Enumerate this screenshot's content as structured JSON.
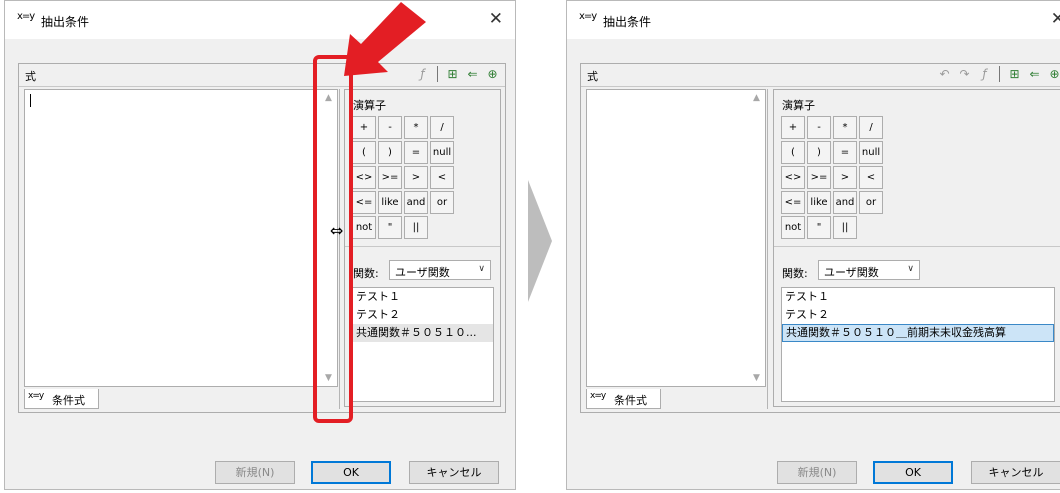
{
  "left": {
    "title": "抽出条件",
    "title_icon": "x=y",
    "formula_label": "式",
    "cond_tab_label": "条件式",
    "op_title": "演算子",
    "operators": [
      "+",
      "-",
      "*",
      "/",
      "(",
      ")",
      "=",
      "null",
      "<>",
      ">=",
      ">",
      "<",
      "<=",
      "like",
      "and",
      "or",
      "not",
      "\"",
      "||"
    ],
    "func_label": "関数:",
    "func_select": "ユーザ関数",
    "functions": [
      "テスト１",
      "テスト２",
      "共通関数＃５０５１０..."
    ],
    "btn_new": "新規(N)",
    "btn_ok": "OK",
    "btn_cancel": "キャンセル"
  },
  "right": {
    "title": "抽出条件",
    "title_icon": "x=y",
    "formula_label": "式",
    "cond_tab_label": "条件式",
    "op_title": "演算子",
    "operators": [
      "+",
      "-",
      "*",
      "/",
      "(",
      ")",
      "=",
      "null",
      "<>",
      ">=",
      ">",
      "<",
      "<=",
      "like",
      "and",
      "or",
      "not",
      "\"",
      "||"
    ],
    "func_label": "関数:",
    "func_select": "ユーザ関数",
    "functions": [
      "テスト１",
      "テスト２",
      "共通関数＃５０５１０＿前期末未収金残高算"
    ],
    "btn_new": "新規(N)",
    "btn_ok": "OK",
    "btn_cancel": "キャンセル"
  },
  "colors": {
    "accent": "#0078d7",
    "highlight": "#e31e24"
  }
}
